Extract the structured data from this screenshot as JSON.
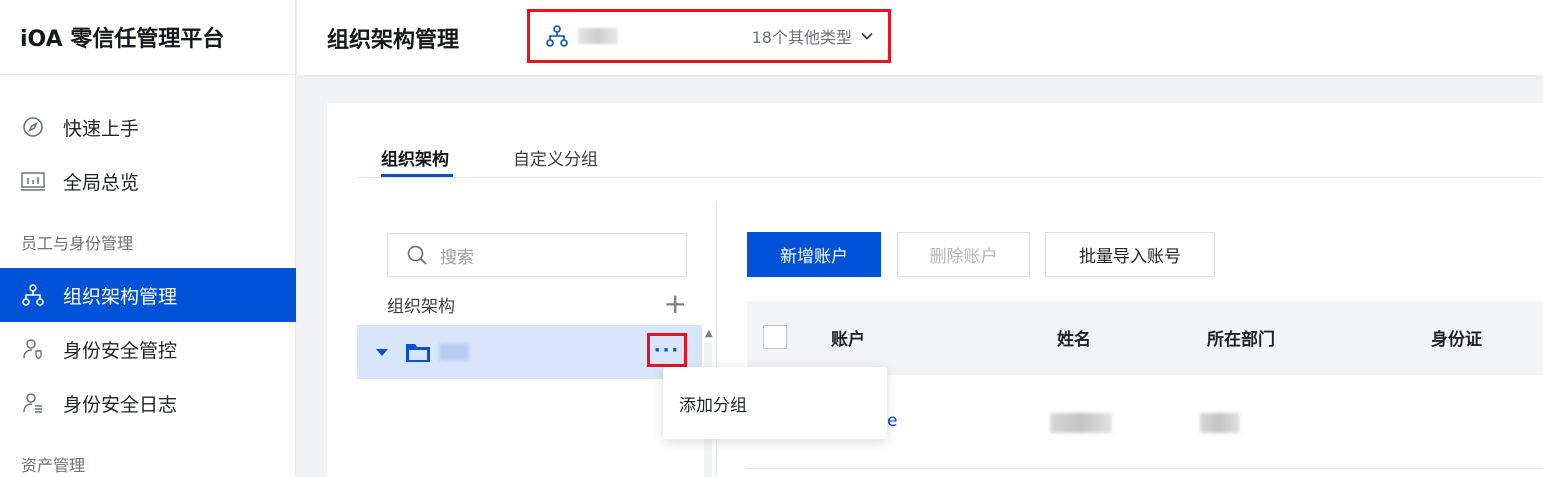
{
  "brand": {
    "title": "iOA 零信任管理平台"
  },
  "sidebar": {
    "items": [
      {
        "label": "快速上手",
        "icon": "compass-icon"
      },
      {
        "label": "全局总览",
        "icon": "dashboard-icon"
      }
    ],
    "section1": "员工与身份管理",
    "identity_items": [
      {
        "label": "组织架构管理",
        "icon": "org-tree-icon",
        "active": true
      },
      {
        "label": "身份安全管控",
        "icon": "user-shield-icon"
      },
      {
        "label": "身份安全日志",
        "icon": "user-log-icon"
      }
    ],
    "section2": "资产管理"
  },
  "header": {
    "title": "组织架构管理",
    "org_selector": {
      "types_label": "18个其他类型"
    }
  },
  "tabs": [
    {
      "label": "组织架构",
      "active": true
    },
    {
      "label": "自定义分组",
      "active": false
    }
  ],
  "tree": {
    "search_placeholder": "搜索",
    "heading": "组织架构",
    "more_label": "···",
    "menu": {
      "add_group": "添加分组"
    }
  },
  "toolbar": {
    "add_account": "新增账户",
    "delete_account": "删除账户",
    "batch_import": "批量导入账号"
  },
  "table": {
    "columns": [
      "账户",
      "姓名",
      "所在部门",
      "身份证"
    ],
    "rows": [
      {
        "account_suffix": "e"
      }
    ]
  },
  "colors": {
    "accent": "#0052d9",
    "highlight_border": "#e8131e",
    "selected_row": "#d9e5fb"
  }
}
